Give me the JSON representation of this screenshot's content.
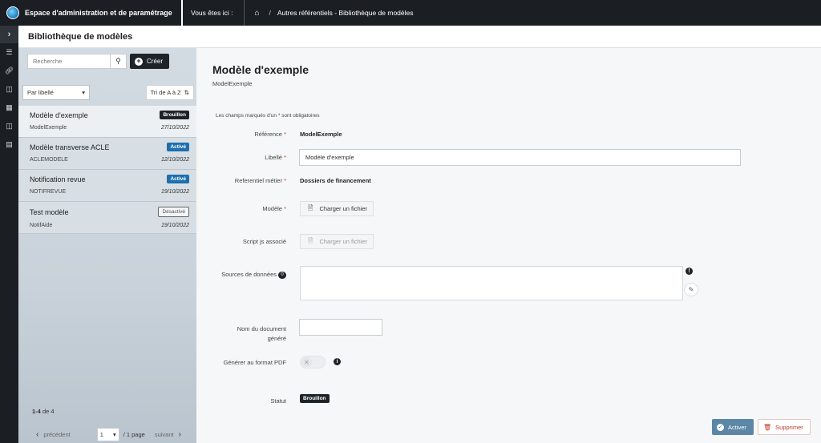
{
  "header": {
    "app_title": "Espace d'administration et de paramétrage",
    "location_label": "Vous êtes ici :",
    "breadcrumb": "Autres référentiels - Bibliothèque de modèles"
  },
  "page": {
    "title": "Bibliothèque de modèles"
  },
  "list": {
    "search_placeholder": "Recherche",
    "create_label": "Créer",
    "filter_selected": "Par libellé",
    "sort_label": "Tri de A à Z",
    "items": [
      {
        "name": "Modèle d'exemple",
        "badge": "Brouillon",
        "ref": "ModelExemple",
        "date": "27/10/2022"
      },
      {
        "name": "Modèle transverse ACLE",
        "badge": "Activé",
        "ref": "ACLEMODELE",
        "date": "12/10/2022"
      },
      {
        "name": "Notification revue",
        "badge": "Activé",
        "ref": "NOTIFREVUE",
        "date": "19/10/2022"
      },
      {
        "name": "Test modèle",
        "badge": "Désactivé",
        "ref": "NotifAide",
        "date": "19/10/2022"
      }
    ],
    "range": "1-4",
    "range_total": "de 4",
    "prev_label": "précédent",
    "page_value": "1",
    "page_total": "/ 1 page",
    "next_label": "suivant"
  },
  "form": {
    "title": "Modèle d'exemple",
    "subtitle": "ModelExemple",
    "required_hint": "Les champs marqués d'un * sont obligatoires",
    "reference_label": "Référence",
    "reference_value": "ModelExemple",
    "libelle_label": "Libellé",
    "libelle_value": "Modèle d'exemple",
    "referentiel_label": "Referentiel métier",
    "referentiel_value": "Dossiers de financement",
    "modele_label": "Modèle",
    "upload_label": "Charger un fichier",
    "script_label": "Script js associé",
    "script_upload_label": "Charger un fichier",
    "sources_label": "Sources de données",
    "sources_count": "0",
    "docname_label_1": "Nom du document",
    "docname_label_2": "généré",
    "pdf_label": "Générer au format PDF",
    "status_label": "Statut",
    "status_value": "Brouillon",
    "required_mark": "*"
  },
  "actions": {
    "activate_label": "Activer",
    "delete_label": "Supprimer"
  },
  "colors": {
    "topbar": "#1b1f24",
    "badge_active": "#1d6fb0",
    "activate_button": "#5b86a6",
    "delete_text": "#c0392b"
  }
}
